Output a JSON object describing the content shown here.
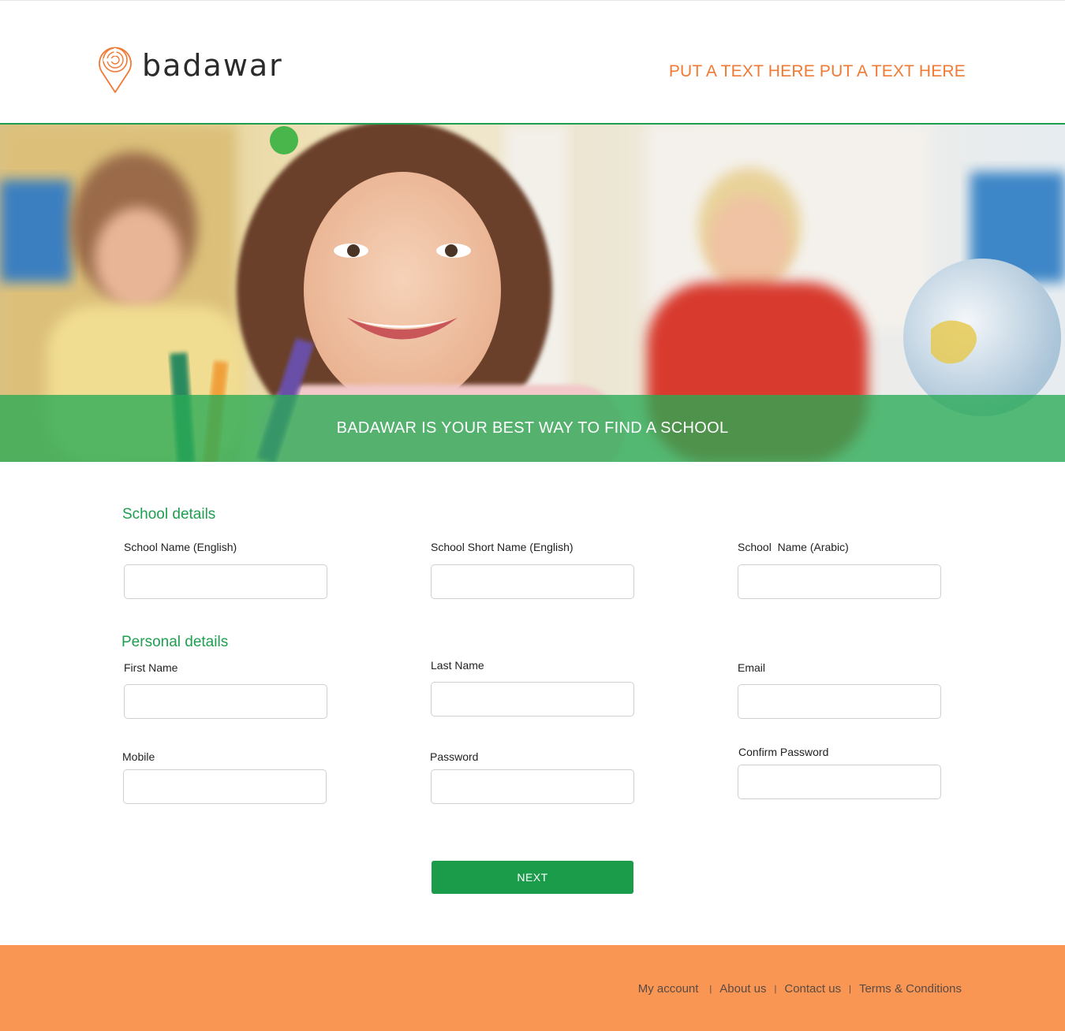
{
  "header": {
    "logo_text": "badawar",
    "tagline": "PUT A TEXT HERE PUT A TEXT HERE"
  },
  "hero": {
    "banner_text": "BADAWAR IS YOUR BEST WAY TO FIND A SCHOOL"
  },
  "school_section": {
    "title": "School details",
    "fields": [
      {
        "label": "School Name (English)",
        "value": ""
      },
      {
        "label": "School Short Name (English)",
        "value": ""
      },
      {
        "label": "School  Name (Arabic)",
        "value": ""
      }
    ]
  },
  "personal_section": {
    "title": "Personal details",
    "fields": [
      {
        "label": "First Name",
        "value": ""
      },
      {
        "label": "Last Name",
        "value": ""
      },
      {
        "label": "Email",
        "value": ""
      },
      {
        "label": "Mobile",
        "value": ""
      },
      {
        "label": "Password",
        "value": ""
      },
      {
        "label": "Confirm Password",
        "value": ""
      }
    ]
  },
  "next_button": "NEXT",
  "footer": {
    "links": [
      "My account",
      "About us",
      "Contact us",
      "Terms & Conditions"
    ],
    "separator": "|"
  },
  "colors": {
    "brand_green": "#1e9e4f",
    "brand_orange": "#f07a34",
    "footer_orange": "#f99654"
  },
  "icons": {
    "logo": "map-pin-icon"
  }
}
